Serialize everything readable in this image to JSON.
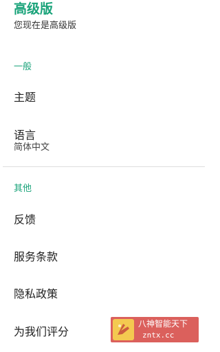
{
  "premium": {
    "title": "高级版",
    "subtitle": "您现在是高级版"
  },
  "general": {
    "header": "一般",
    "items": [
      {
        "label": "主题"
      },
      {
        "label": "语言",
        "value": "简体中文"
      }
    ]
  },
  "other": {
    "header": "其他",
    "items": [
      {
        "label": "反馈"
      },
      {
        "label": "服务条款"
      },
      {
        "label": "隐私政策"
      },
      {
        "label": "为我们评分"
      }
    ]
  },
  "watermark": {
    "name": "八神智能天下",
    "url": "zntx.cc"
  },
  "colors": {
    "accent": "#1aa37a",
    "watermark_bg": "#d9534f"
  }
}
